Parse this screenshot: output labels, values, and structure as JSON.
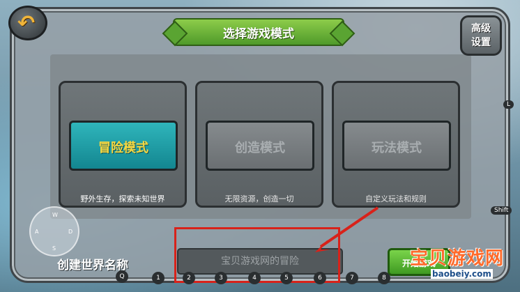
{
  "header": {
    "title": "选择游戏模式",
    "advanced_settings": "高级\n设置"
  },
  "modes": [
    {
      "label": "冒险模式",
      "description": "野外生存，探索未知世界",
      "state": "active"
    },
    {
      "label": "创造模式",
      "description": "无限资源，创造一切",
      "state": "locked"
    },
    {
      "label": "玩法模式",
      "description": "自定义玩法和规则",
      "state": "locked"
    }
  ],
  "world_name": {
    "label": "创建世界名称",
    "value": "宝贝游戏网的冒险"
  },
  "start_button": {
    "label": "开始游戏"
  },
  "joystick": {
    "w": "W",
    "a": "A",
    "s": "S",
    "d": "D"
  },
  "key_hints": [
    "Q",
    "1",
    "2",
    "3",
    "4",
    "5",
    "6",
    "7",
    "8"
  ],
  "side_keys": {
    "l": "L",
    "shift": "Shift"
  },
  "watermark": {
    "text": "宝贝游戏网",
    "url": "baobeiy.com"
  },
  "icons": {
    "back": "back-arrow-icon"
  },
  "colors": {
    "accent_green": "#5aa432",
    "active_mode": "#1ea0a8",
    "highlight": "#d8221a"
  }
}
